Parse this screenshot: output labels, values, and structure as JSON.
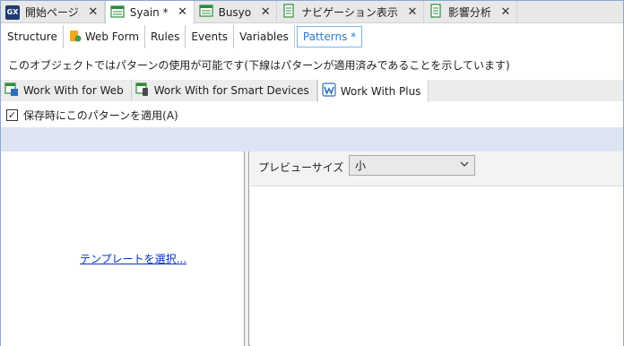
{
  "document_tabs": [
    {
      "label": "開始ページ",
      "icon": "gx-icon"
    },
    {
      "label": "Syain *",
      "icon": "transaction-icon",
      "active": true
    },
    {
      "label": "Busyo",
      "icon": "transaction-icon"
    },
    {
      "label": "ナビゲーション表示",
      "icon": "report-icon"
    },
    {
      "label": "影響分析",
      "icon": "report-icon"
    }
  ],
  "gx_icon_text": "GX",
  "close_glyph": "✕",
  "part_tabs": [
    "Structure",
    "Web Form",
    "Rules",
    "Events",
    "Variables",
    "Patterns *"
  ],
  "info_text": "このオブジェクトではパターンの使用が可能です(下線はパターンが適用済みであることを示しています)",
  "pattern_tabs": [
    {
      "label": "Work With for Web",
      "icon": "workwith-icon"
    },
    {
      "label": "Work With for Smart Devices",
      "icon": "workwith-sd-icon"
    },
    {
      "label": "Work With Plus",
      "icon": "wwplus-icon",
      "active": true
    }
  ],
  "apply_checkbox": {
    "label": "保存時にこのパターンを適用(A)",
    "checked": true,
    "check_glyph": "✓"
  },
  "left_panel": {
    "link": "テンプレートを選択..."
  },
  "preview": {
    "label": "プレビューサイズ",
    "selected": "小",
    "arrow_glyph": "⌄"
  },
  "colors": {
    "accent": "#2a7bd1",
    "link": "#0033cc",
    "band": "#dde5f3"
  }
}
